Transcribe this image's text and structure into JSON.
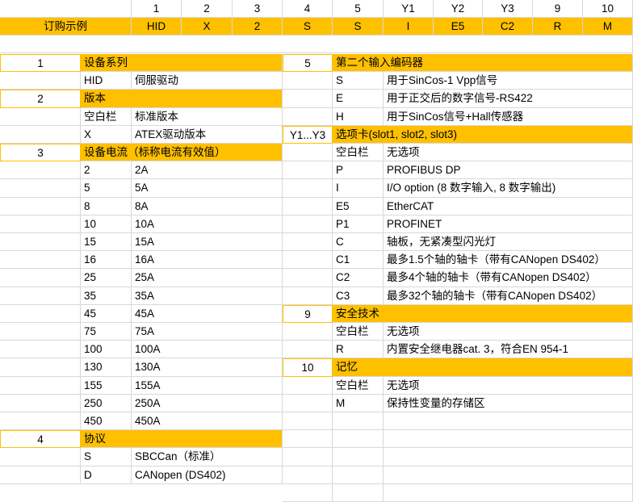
{
  "header": {
    "codes": [
      "1",
      "2",
      "3",
      "4",
      "5",
      "Y1",
      "Y2",
      "Y3",
      "9",
      "10"
    ],
    "title": "订购示例",
    "example": [
      "HID",
      "X",
      "2",
      "S",
      "S",
      "I",
      "E5",
      "C2",
      "R",
      "M"
    ]
  },
  "left": {
    "s1": {
      "num": "1",
      "title": "设备系列",
      "rows": [
        [
          "HID",
          "伺服驱动"
        ]
      ]
    },
    "s2": {
      "num": "2",
      "title": "版本",
      "rows": [
        [
          "空白栏",
          "标准版本"
        ],
        [
          "X",
          "ATEX驱动版本"
        ]
      ]
    },
    "s3": {
      "num": "3",
      "title": "设备电流（标称电流有效值）",
      "rows": [
        [
          "2",
          "2A"
        ],
        [
          "5",
          "5A"
        ],
        [
          "8",
          "8A"
        ],
        [
          "10",
          "10A"
        ],
        [
          "15",
          "15A"
        ],
        [
          "16",
          "16A"
        ],
        [
          "25",
          "25A"
        ],
        [
          "35",
          "35A"
        ],
        [
          "45",
          "45A"
        ],
        [
          "75",
          "75A"
        ],
        [
          "100",
          "100A"
        ],
        [
          "130",
          "130A"
        ],
        [
          "155",
          "155A"
        ],
        [
          "250",
          "250A"
        ],
        [
          "450",
          "450A"
        ]
      ]
    },
    "s4": {
      "num": "4",
      "title": "协议",
      "rows": [
        [
          "S",
          "SBCCan（标准）"
        ],
        [
          "D",
          "CANopen (DS402)"
        ]
      ]
    }
  },
  "right": {
    "s5": {
      "num": "5",
      "title": "第二个输入编码器",
      "rows": [
        [
          "S",
          "用于SinCos-1 Vpp信号"
        ],
        [
          "E",
          "用于正交后的数字信号-RS422"
        ],
        [
          "H",
          "用于SinCos信号+Hall传感器"
        ]
      ]
    },
    "sY": {
      "num": "Y1...Y3",
      "title": "选项卡(slot1, slot2, slot3)",
      "rows": [
        [
          "空白栏",
          "无选项"
        ],
        [
          "P",
          "PROFIBUS DP"
        ],
        [
          "I",
          "I/O option (8 数字输入, 8 数字输出)"
        ],
        [
          "E5",
          "EtherCAT"
        ],
        [
          "P1",
          "PROFINET"
        ],
        [
          "C",
          "轴板，无紧凑型闪光灯"
        ],
        [
          "C1",
          "最多1.5个轴的轴卡（带有CANopen DS402）"
        ],
        [
          "C2",
          "最多4个轴的轴卡（带有CANopen DS402）"
        ],
        [
          "C3",
          "最多32个轴的轴卡（带有CANopen DS402）"
        ]
      ]
    },
    "s9": {
      "num": "9",
      "title": "安全技术",
      "rows": [
        [
          "空白栏",
          "无选项"
        ],
        [
          "R",
          "内置安全继电器cat. 3，符合EN 954-1"
        ]
      ]
    },
    "s10": {
      "num": "10",
      "title": "记忆",
      "rows": [
        [
          "空白栏",
          "无选项"
        ],
        [
          "M",
          "保持性变量的存储区"
        ]
      ]
    }
  }
}
